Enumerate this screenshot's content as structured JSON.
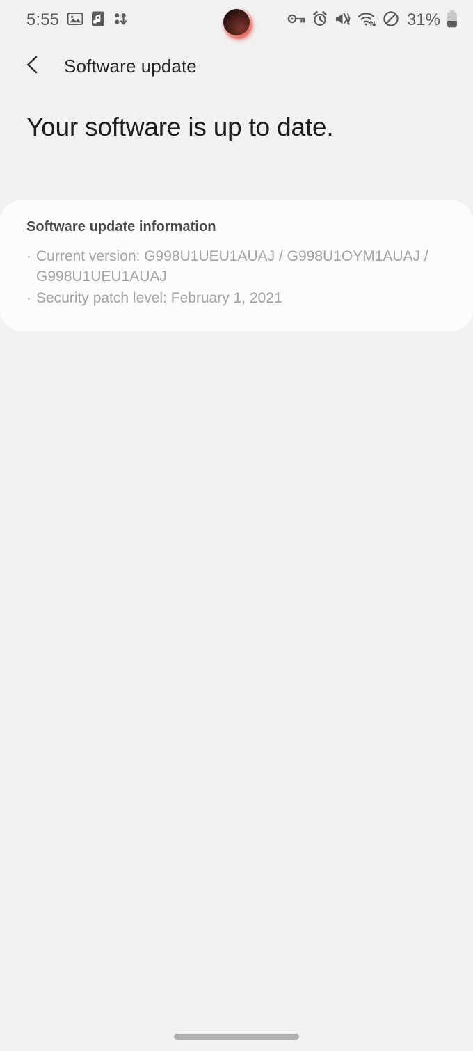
{
  "status_bar": {
    "time": "5:55",
    "battery_percent": "31%",
    "left_icons": [
      "image-icon",
      "music-note-icon",
      "smart-switch-icon"
    ],
    "right_icons": [
      "vpn-key-icon",
      "alarm-icon",
      "mute-vibrate-icon",
      "wifi-icon",
      "do-not-disturb-icon",
      "battery-icon"
    ],
    "colors": {
      "icon": "#5b5b5b",
      "background": "#f1f1f1"
    }
  },
  "app_bar": {
    "back_icon": "chevron-left-icon",
    "title": "Software update"
  },
  "main": {
    "headline": "Your software is up to date.",
    "card": {
      "title": "Software update information",
      "lines": [
        {
          "bullet": "·",
          "text": "Current version: G998U1UEU1AUAJ / G998U1OYM1AUAJ / G998U1UEU1AUAJ"
        },
        {
          "bullet": "·",
          "text": "Security patch level: February 1, 2021"
        }
      ]
    }
  },
  "theme": {
    "background": "#f1f1f1",
    "card_background": "#fbfbfb",
    "title_text": "#252525",
    "headline_text": "#1d1d1d",
    "card_title_text": "#4a4a4a",
    "body_text": "#a2a2a2",
    "gesture_bar": "#b0b0b0"
  }
}
